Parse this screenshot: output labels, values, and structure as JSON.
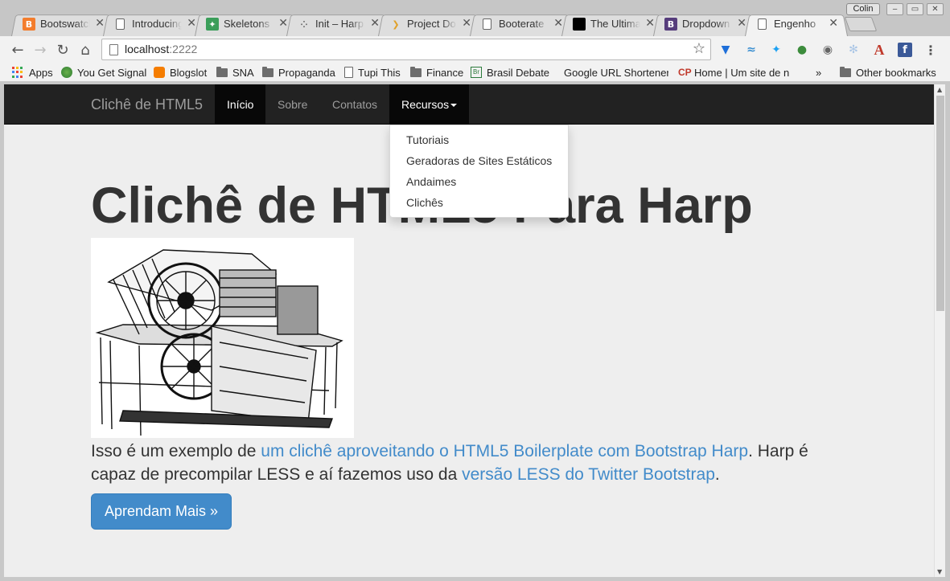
{
  "browser": {
    "tabs": [
      {
        "title": "Bootswatch",
        "favicon": "bootstrap-orange-icon",
        "icon_char": "B",
        "color": "#f37d2d"
      },
      {
        "title": "Introducing",
        "favicon": "document-icon"
      },
      {
        "title": "Skeletons",
        "favicon": "skeleton-green-icon",
        "icon_char": "✦",
        "color": "#3b9e5a"
      },
      {
        "title": "Init – Harp",
        "favicon": "harp-icon",
        "icon_char": "⁘",
        "color": "#888888"
      },
      {
        "title": "Project Do",
        "favicon": "project-icon",
        "icon_char": "❯",
        "color": "#e0a12a"
      },
      {
        "title": "Booterate",
        "favicon": "document-icon"
      },
      {
        "title": "The Ultima",
        "favicon": "black-square-icon",
        "icon_char": "",
        "color": "#000000"
      },
      {
        "title": "Dropdown",
        "favicon": "bootstrap-purple-icon",
        "icon_char": "B",
        "color": "#563d7c"
      },
      {
        "title": "Engenho",
        "favicon": "document-icon",
        "active": true
      }
    ],
    "profile_name": "Colin",
    "url_host": "localhost",
    "url_port": ":2222",
    "bookmarks": [
      {
        "label": "Apps",
        "icon": "apps-grid-icon"
      },
      {
        "label": "You Get Signal",
        "icon": "globe-icon"
      },
      {
        "label": "Blogslot",
        "icon": "blogger-icon"
      },
      {
        "label": "SNA",
        "icon": "folder-icon"
      },
      {
        "label": "Propaganda",
        "icon": "folder-icon"
      },
      {
        "label": "Tupi This",
        "icon": "document-icon"
      },
      {
        "label": "Finance",
        "icon": "folder-icon"
      },
      {
        "label": "Brasil Debate",
        "icon": "brasil-debate-icon"
      },
      {
        "label": "Google URL Shortener",
        "icon": "google-icon"
      },
      {
        "label": "Home | Um site de n",
        "icon": "cp-icon"
      }
    ],
    "bookmarks_overflow": "»",
    "other_bookmarks": "Other bookmarks"
  },
  "page": {
    "brand": "Clichê de HTML5",
    "nav": [
      "Início",
      "Sobre",
      "Contatos",
      "Recursos"
    ],
    "dropdown": [
      "Tutoriais",
      "Geradoras de Sites Estáticos",
      "Andaimes",
      "Clichês"
    ],
    "heading": "Clichê de HTML5 Para Harp",
    "para_1": "Isso é um exemplo de ",
    "para_link_1": "um clichê aproveitando o HTML5 Boilerplate com Bootstrap Harp",
    "para_2": ". Harp é capaz de precompilar LESS e aí fazemos uso da ",
    "para_link_2": "versão LESS do Twitter Bootstrap",
    "para_3": ".",
    "button": "Aprendam Mais »"
  },
  "colors": {
    "navbar": "#222222",
    "link": "#428bca",
    "button": "#428bca",
    "page_bg": "#eeeeee"
  }
}
